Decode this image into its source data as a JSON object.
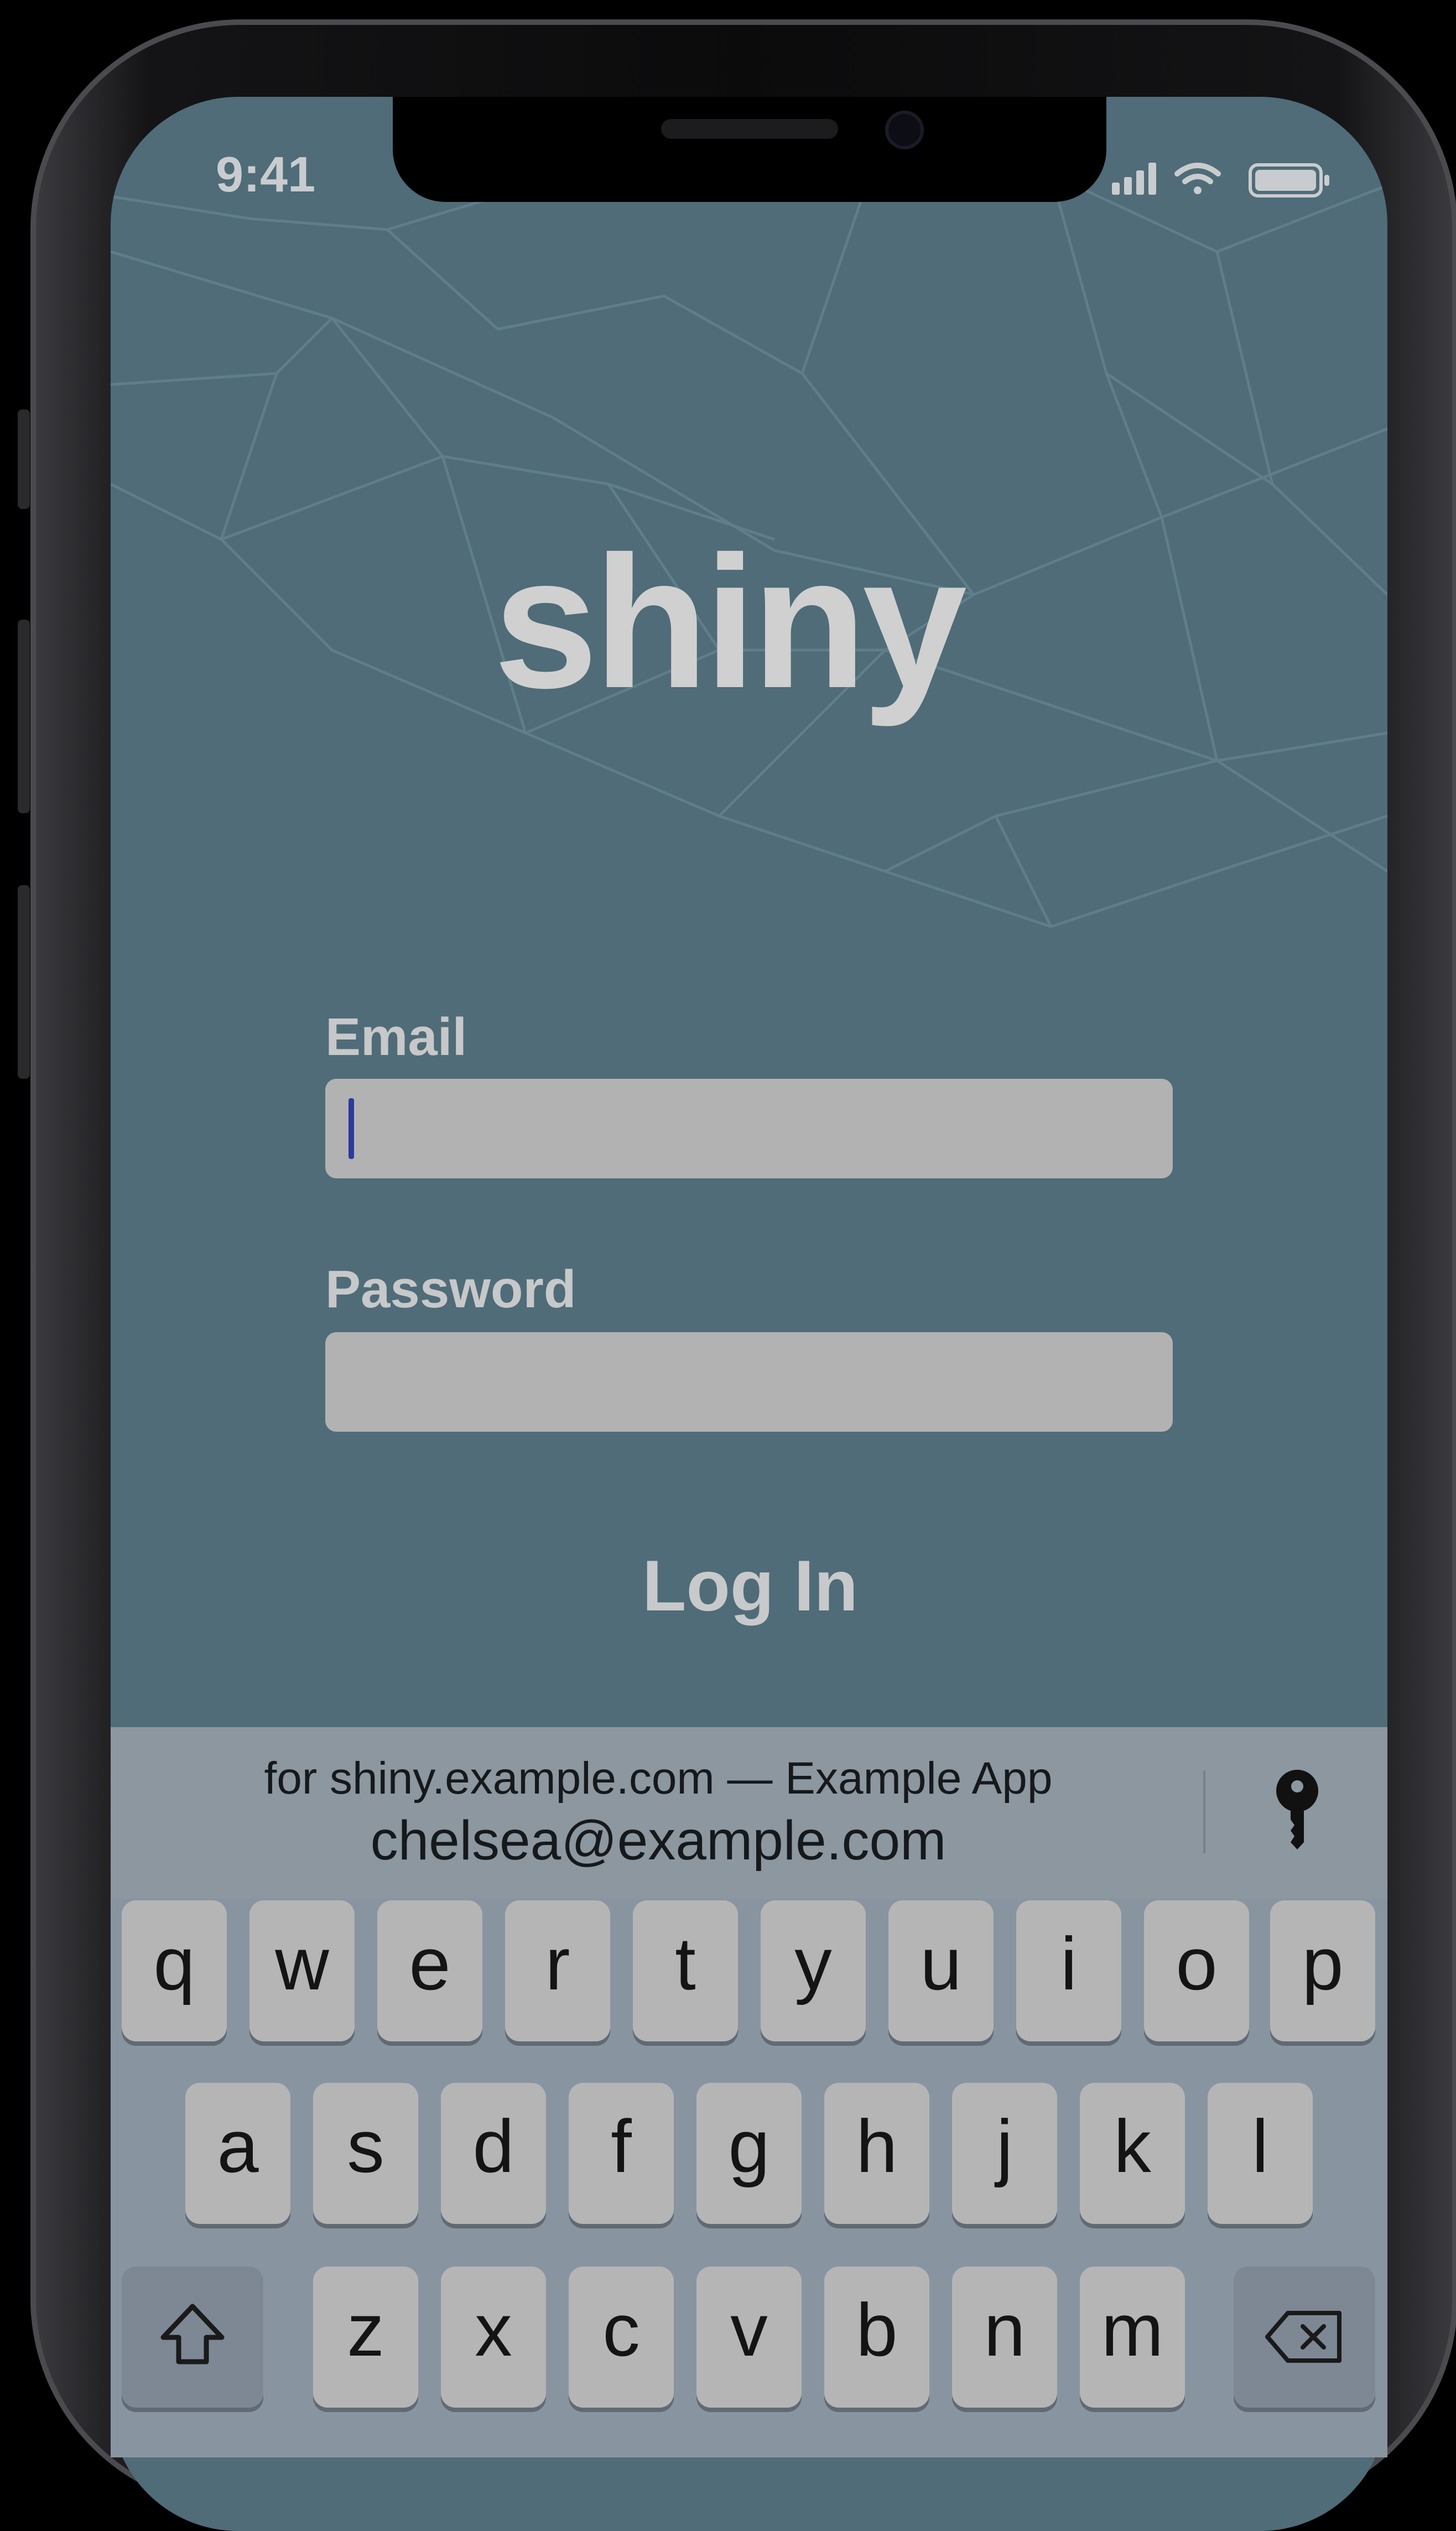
{
  "status_bar": {
    "time": "9:41",
    "signal_icon": "cellular-signal-icon",
    "wifi_icon": "wifi-icon",
    "battery_icon": "battery-icon"
  },
  "app": {
    "logo_text": "shiny",
    "background_color": "#4f6c78"
  },
  "login_form": {
    "email_label": "Email",
    "email_value": "",
    "password_label": "Password",
    "password_value": "",
    "login_button_label": "Log In"
  },
  "quicktype_bar": {
    "credential_title": "for shiny.example.com — Example App",
    "credential_email": "chelsea@example.com",
    "passwords_icon": "key-icon"
  },
  "keyboard": {
    "row1": [
      "q",
      "w",
      "e",
      "r",
      "t",
      "y",
      "u",
      "i",
      "o",
      "p"
    ],
    "row2": [
      "a",
      "s",
      "d",
      "f",
      "g",
      "h",
      "j",
      "k",
      "l"
    ],
    "row3": [
      "z",
      "x",
      "c",
      "v",
      "b",
      "n",
      "m"
    ],
    "shift_icon": "shift-arrow-icon",
    "delete_icon": "delete-backspace-icon"
  }
}
